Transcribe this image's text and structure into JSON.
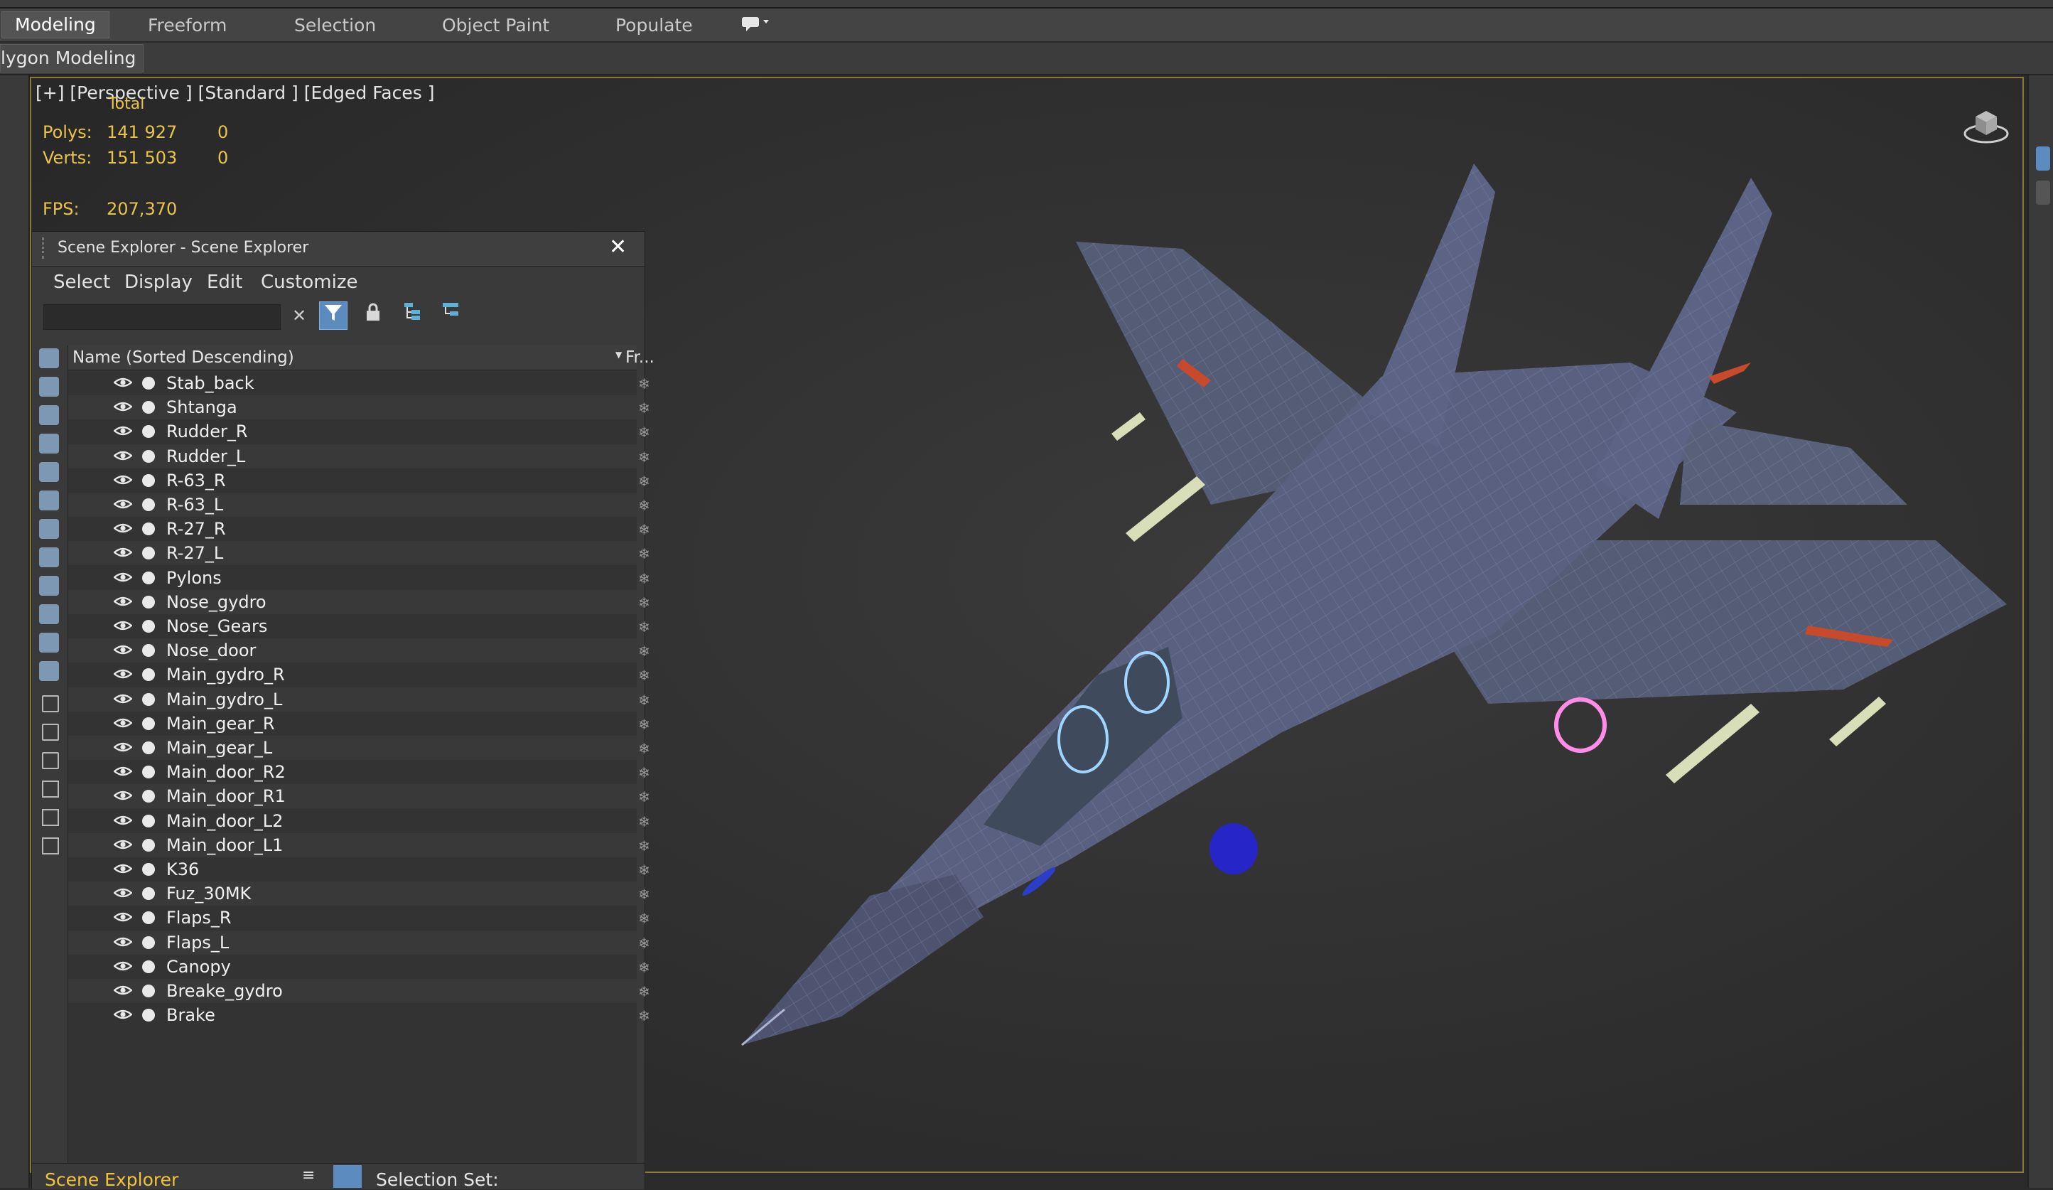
{
  "ribbon": {
    "tabs": [
      {
        "label": "Modeling",
        "active": true
      },
      {
        "label": "Freeform",
        "active": false
      },
      {
        "label": "Selection",
        "active": false
      },
      {
        "label": "Object Paint",
        "active": false
      },
      {
        "label": "Populate",
        "active": false
      }
    ],
    "sub_label": "lygon Modeling"
  },
  "viewport": {
    "label": "[+] [Perspective ]  [Standard ]  [Edged Faces ]",
    "stats": {
      "total_label": "Total",
      "polys_label": "Polys:",
      "polys_total": "141 927",
      "polys_sel": "0",
      "verts_label": "Verts:",
      "verts_total": "151 503",
      "verts_sel": "0",
      "fps_label": "FPS:",
      "fps_value": "207,370"
    }
  },
  "scene_explorer": {
    "title": "Scene Explorer - Scene Explorer",
    "close": "✕",
    "menu": [
      "Select",
      "Display",
      "Edit",
      "Customize"
    ],
    "column_name": "Name (Sorted Descending)",
    "column_frozen": "Fr...",
    "items": [
      "Stab_back",
      "Shtanga",
      "Rudder_R",
      "Rudder_L",
      "R-63_R",
      "R-63_L",
      "R-27_R",
      "R-27_L",
      "Pylons",
      "Nose_gydro",
      "Nose_Gears",
      "Nose_door",
      "Main_gydro_R",
      "Main_gydro_L",
      "Main_gear_R",
      "Main_gear_L",
      "Main_door_R2",
      "Main_door_R1",
      "Main_door_L2",
      "Main_door_L1",
      "K36",
      "Fuz_30MK",
      "Flaps_R",
      "Flaps_L",
      "Canopy",
      "Breake_gydro",
      "Brake"
    ],
    "bottom_label": "Scene Explorer",
    "selection_set_label": "Selection Set:"
  },
  "colors": {
    "stats_yellow": "#e8c44a",
    "accent_blue": "#5b8bbf",
    "viewport_border": "#8a7a3a"
  }
}
